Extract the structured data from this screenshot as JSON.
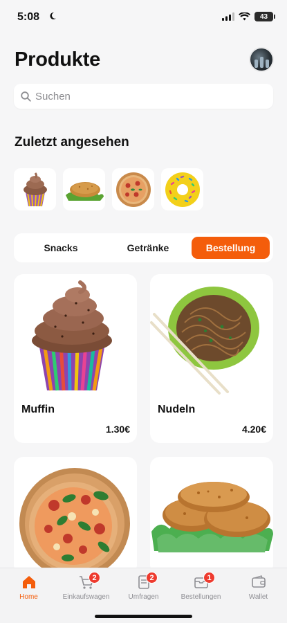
{
  "status": {
    "time": "5:08",
    "battery": "43"
  },
  "header": {
    "title": "Produkte"
  },
  "search": {
    "placeholder": "Suchen"
  },
  "recent": {
    "title": "Zuletzt angesehen",
    "items": [
      "cupcake-thumbnail",
      "schnitzel-thumbnail",
      "pizza-thumbnail",
      "donut-thumbnail"
    ]
  },
  "tabs": [
    {
      "label": "Snacks",
      "active": false
    },
    {
      "label": "Getränke",
      "active": false
    },
    {
      "label": "Bestellung",
      "active": true
    }
  ],
  "products": [
    {
      "name": "Muffin",
      "price": "1.30€",
      "image": "muffin-image"
    },
    {
      "name": "Nudeln",
      "price": "4.20€",
      "image": "noodles-image"
    },
    {
      "name": "",
      "price": "",
      "image": "pizza-image"
    },
    {
      "name": "",
      "price": "",
      "image": "schnitzel-image"
    }
  ],
  "tabbar": [
    {
      "label": "Home",
      "icon": "home-icon",
      "active": true,
      "badge": ""
    },
    {
      "label": "Einkaufswagen",
      "icon": "cart-icon",
      "active": false,
      "badge": "2"
    },
    {
      "label": "Umfragen",
      "icon": "survey-icon",
      "active": false,
      "badge": "2"
    },
    {
      "label": "Bestellungen",
      "icon": "orders-icon",
      "active": false,
      "badge": "1"
    },
    {
      "label": "Wallet",
      "icon": "wallet-icon",
      "active": false,
      "badge": ""
    }
  ],
  "colors": {
    "accent": "#f45d0b",
    "badge": "#ee3b2f",
    "background": "#f6f6f7"
  }
}
